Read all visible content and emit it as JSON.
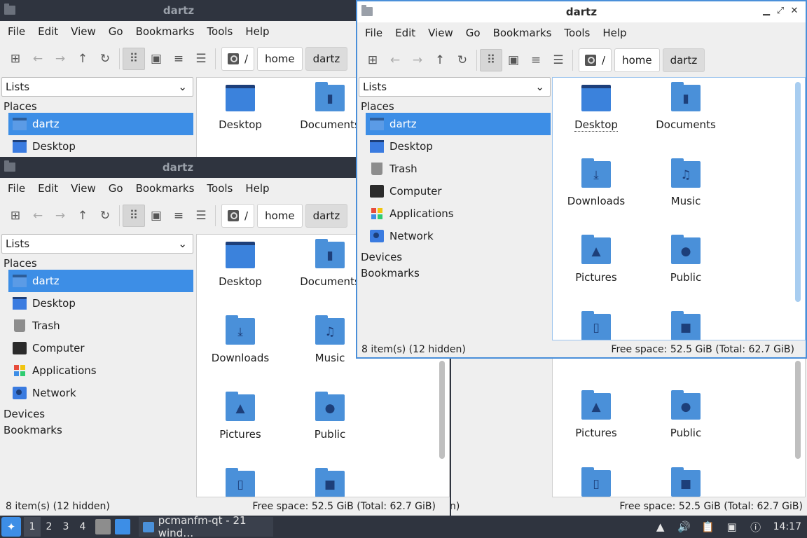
{
  "window_title": "dartz",
  "menu": [
    "File",
    "Edit",
    "View",
    "Go",
    "Bookmarks",
    "Tools",
    "Help"
  ],
  "path": {
    "root": "/",
    "parts": [
      "home",
      "dartz"
    ]
  },
  "side_combo": "Lists",
  "sections": {
    "places": "Places",
    "devices": "Devices",
    "bookmarks": "Bookmarks"
  },
  "places": [
    "dartz",
    "Desktop",
    "Trash",
    "Computer",
    "Applications",
    "Network"
  ],
  "files": [
    "Desktop",
    "Documents",
    "Downloads",
    "Music",
    "Pictures",
    "Public"
  ],
  "status": {
    "items": "8 item(s) (12 hidden)",
    "free": "Free space: 52.5 GiB (Total: 62.7 GiB)",
    "clipped_fragment": "n)"
  },
  "taskbar": {
    "desktops": [
      "1",
      "2",
      "3",
      "4"
    ],
    "task_label": "pcmanfm-qt - 21 wind…",
    "clock": "14:17"
  },
  "icons": {
    "new_tab": "tab-new-icon",
    "back": "back-arrow-icon",
    "forward": "forward-arrow-icon",
    "up": "up-arrow-icon",
    "reload": "reload-icon",
    "icon_view": "grid-view-icon",
    "thumb_view": "thumbnail-view-icon",
    "compact_view": "compact-view-icon",
    "detail_view": "detail-list-icon"
  }
}
